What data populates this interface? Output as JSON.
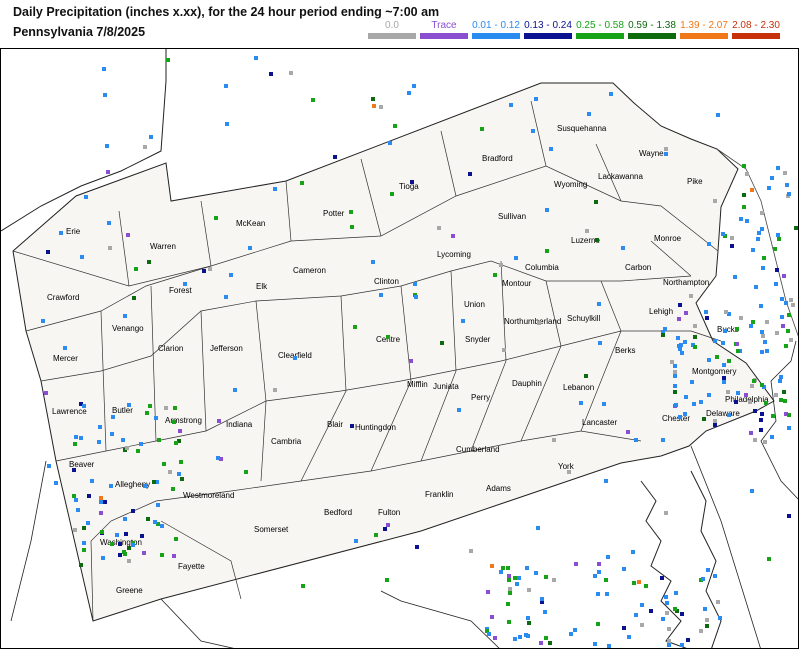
{
  "header": {
    "title": "Daily Precipitation (inches  x.xx),  for the 24 hour period ending ~7:00 am",
    "subtitle": "Pennsylvania 7/8/2025"
  },
  "legend": [
    {
      "label": "0.0",
      "color": "#a8a8a8"
    },
    {
      "label": "Trace",
      "color": "#8a4fd0"
    },
    {
      "label": "0.01 - 0.12",
      "color": "#2a8cf0"
    },
    {
      "label": "0.13 - 0.24",
      "color": "#0a1290"
    },
    {
      "label": "0.25 - 0.58",
      "color": "#17a317"
    },
    {
      "label": "0.59 - 1.38",
      "color": "#0e6a0e"
    },
    {
      "label": "1.39 - 2.07",
      "color": "#f07818"
    },
    {
      "label": "2.08 - 2.30",
      "color": "#c8300a"
    }
  ],
  "counties": [
    {
      "name": "Erie"
    },
    {
      "name": "Warren"
    },
    {
      "name": "McKean"
    },
    {
      "name": "Potter"
    },
    {
      "name": "Tioga"
    },
    {
      "name": "Bradford"
    },
    {
      "name": "Susquehanna"
    },
    {
      "name": "Wayne"
    },
    {
      "name": "Pike"
    },
    {
      "name": "Wyoming"
    },
    {
      "name": "Lackawanna"
    },
    {
      "name": "Sullivan"
    },
    {
      "name": "Luzerne"
    },
    {
      "name": "Monroe"
    },
    {
      "name": "Carbon"
    },
    {
      "name": "Northampton"
    },
    {
      "name": "Lehigh"
    },
    {
      "name": "Bucks"
    },
    {
      "name": "Montgomery"
    },
    {
      "name": "Philadelphia"
    },
    {
      "name": "Delaware"
    },
    {
      "name": "Chester"
    },
    {
      "name": "Berks"
    },
    {
      "name": "Schuylkill"
    },
    {
      "name": "Columbia"
    },
    {
      "name": "Montour"
    },
    {
      "name": "Northumberland"
    },
    {
      "name": "Lycoming"
    },
    {
      "name": "Union"
    },
    {
      "name": "Snyder"
    },
    {
      "name": "Clinton"
    },
    {
      "name": "Cameron"
    },
    {
      "name": "Elk"
    },
    {
      "name": "Forest"
    },
    {
      "name": "Crawford"
    },
    {
      "name": "Venango"
    },
    {
      "name": "Clarion"
    },
    {
      "name": "Jefferson"
    },
    {
      "name": "Clearfield"
    },
    {
      "name": "Centre"
    },
    {
      "name": "Mifflin"
    },
    {
      "name": "Juniata"
    },
    {
      "name": "Perry"
    },
    {
      "name": "Dauphin"
    },
    {
      "name": "Lebanon"
    },
    {
      "name": "Lancaster"
    },
    {
      "name": "York"
    },
    {
      "name": "Cumberland"
    },
    {
      "name": "Adams"
    },
    {
      "name": "Franklin"
    },
    {
      "name": "Fulton"
    },
    {
      "name": "Bedford"
    },
    {
      "name": "Huntingdon"
    },
    {
      "name": "Blair"
    },
    {
      "name": "Cambria"
    },
    {
      "name": "Indiana"
    },
    {
      "name": "Armstrong"
    },
    {
      "name": "Butler"
    },
    {
      "name": "Mercer"
    },
    {
      "name": "Lawrence"
    },
    {
      "name": "Beaver"
    },
    {
      "name": "Allegheny"
    },
    {
      "name": "Westmoreland"
    },
    {
      "name": "Somerset"
    },
    {
      "name": "Washington"
    },
    {
      "name": "Fayette"
    },
    {
      "name": "Greene"
    }
  ]
}
